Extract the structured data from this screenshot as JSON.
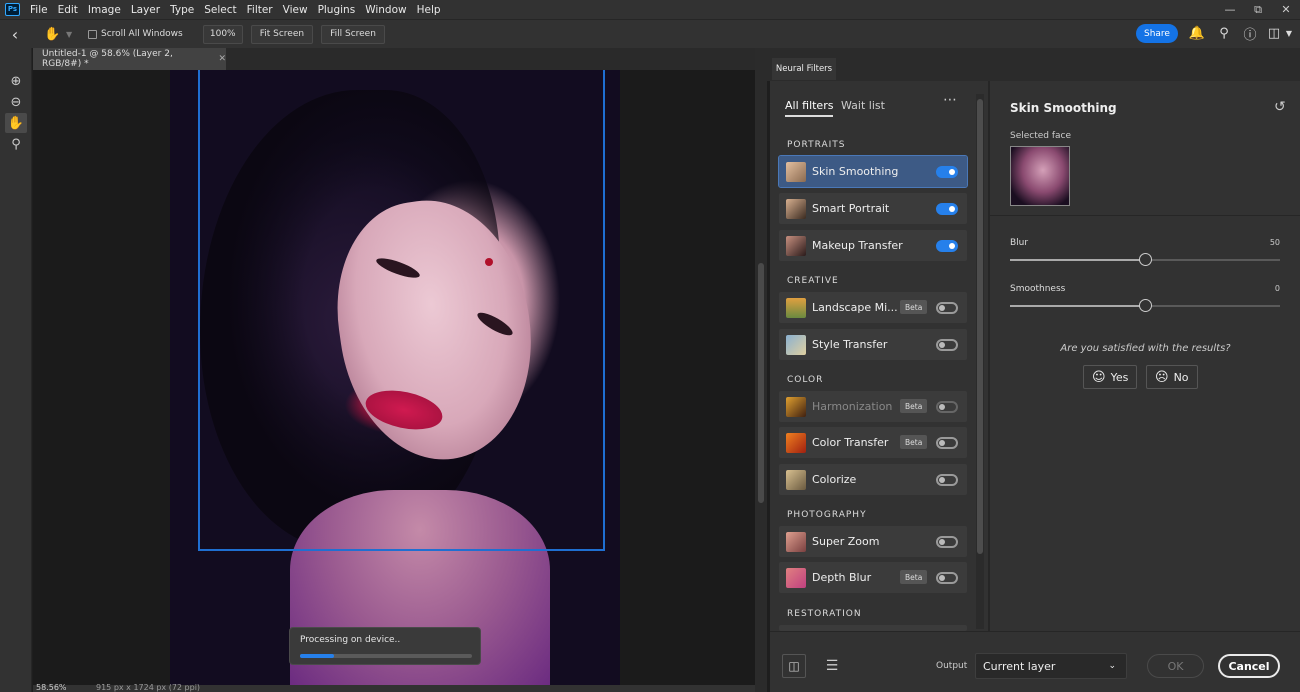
{
  "app": {
    "logo_text": "Ps",
    "accent": "#1473e6"
  },
  "menu": [
    "File",
    "Edit",
    "Image",
    "Layer",
    "Type",
    "Select",
    "Filter",
    "View",
    "Plugins",
    "Window",
    "Help"
  ],
  "options_bar": {
    "scroll_all_windows": "Scroll All Windows",
    "zoom_100": "100%",
    "fit_screen": "Fit Screen",
    "fill_screen": "Fill Screen",
    "share": "Share"
  },
  "document": {
    "tab_title": "Untitled-1 @ 58.6% (Layer 2, RGB/8#) *",
    "status_zoom": "58.56%",
    "status_size": "915 px x 1724 px (72 ppi)"
  },
  "processing": {
    "label": "Processing on device..",
    "progress": 0.2
  },
  "neural_filters": {
    "panel_tab": "Neural Filters",
    "tabs": {
      "all": "All filters",
      "wait": "Wait list"
    },
    "sections": {
      "portraits": "PORTRAITS",
      "creative": "CREATIVE",
      "color": "COLOR",
      "photography": "PHOTOGRAPHY",
      "restoration": "RESTORATION"
    },
    "filters": [
      {
        "name": "Skin Smoothing",
        "on": true,
        "beta": false,
        "selected": true
      },
      {
        "name": "Smart Portrait",
        "on": true,
        "beta": false
      },
      {
        "name": "Makeup Transfer",
        "on": true,
        "beta": false
      },
      {
        "name": "Landscape Mi...",
        "on": false,
        "beta": true
      },
      {
        "name": "Style Transfer",
        "on": false,
        "beta": false
      },
      {
        "name": "Harmonization",
        "on": false,
        "beta": true,
        "disabled": true
      },
      {
        "name": "Color Transfer",
        "on": false,
        "beta": true
      },
      {
        "name": "Colorize",
        "on": false,
        "beta": false
      },
      {
        "name": "Super Zoom",
        "on": false,
        "beta": false
      },
      {
        "name": "Depth Blur",
        "on": false,
        "beta": true
      }
    ],
    "beta_label": "Beta",
    "details": {
      "title": "Skin Smoothing",
      "selected_face": "Selected face",
      "blur": {
        "label": "Blur",
        "value": "50",
        "level": 0.5
      },
      "smoothness": {
        "label": "Smoothness",
        "value": "0",
        "level": 0.5
      },
      "feedback_q": "Are you satisfied with the results?",
      "yes": "Yes",
      "no": "No"
    },
    "footer": {
      "output_label": "Output",
      "output_value": "Current layer",
      "ok": "OK",
      "cancel": "Cancel"
    }
  }
}
